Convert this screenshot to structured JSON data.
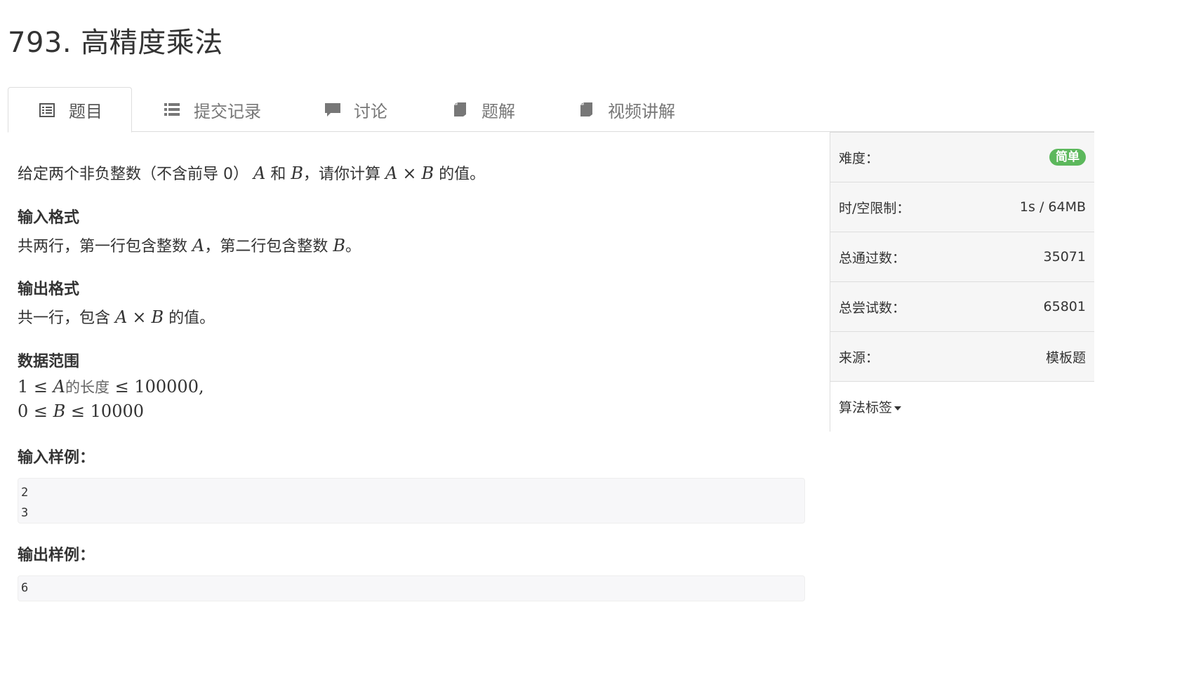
{
  "title": "793. 高精度乘法",
  "tabs": [
    {
      "label": "题目",
      "icon": "list-alt-icon"
    },
    {
      "label": "提交记录",
      "icon": "list-icon"
    },
    {
      "label": "讨论",
      "icon": "comment-icon"
    },
    {
      "label": "题解",
      "icon": "book-icon"
    },
    {
      "label": "视频讲解",
      "icon": "book-icon"
    }
  ],
  "problem": {
    "desc_pre": "给定两个非负整数（不含前导 0）",
    "desc_and": "和",
    "desc_mid": "，请你计算",
    "desc_post": "的值。",
    "var_a": "A",
    "var_b": "B",
    "times": "×",
    "input_heading": "输入格式",
    "input_text_1": "共两行，第一行包含整数",
    "input_text_2": "，第二行包含整数",
    "input_text_3": "。",
    "output_heading": "输出格式",
    "output_text_1": "共一行，包含",
    "output_text_2": "的值。",
    "range_heading": "数据范围",
    "range_line1_left": "1 ≤ ",
    "range_line1_len": "的长度",
    "range_line1_right": " ≤ 100000,",
    "range_line2_left": "0 ≤ ",
    "range_line2_right": " ≤ 10000",
    "sample_input_heading": "输入样例：",
    "sample_input_lines": [
      "2",
      "3"
    ],
    "sample_output_heading": "输出样例：",
    "sample_output_lines": [
      "6"
    ]
  },
  "sidebar": {
    "difficulty_label": "难度：",
    "difficulty_value": "简单",
    "difficulty_color": "#5cb85c",
    "limit_label": "时/空限制：",
    "limit_value": "1s / 64MB",
    "passed_label": "总通过数：",
    "passed_value": "35071",
    "tried_label": "总尝试数：",
    "tried_value": "65801",
    "source_label": "来源：",
    "source_value": "模板题",
    "tags_label": "算法标签"
  }
}
